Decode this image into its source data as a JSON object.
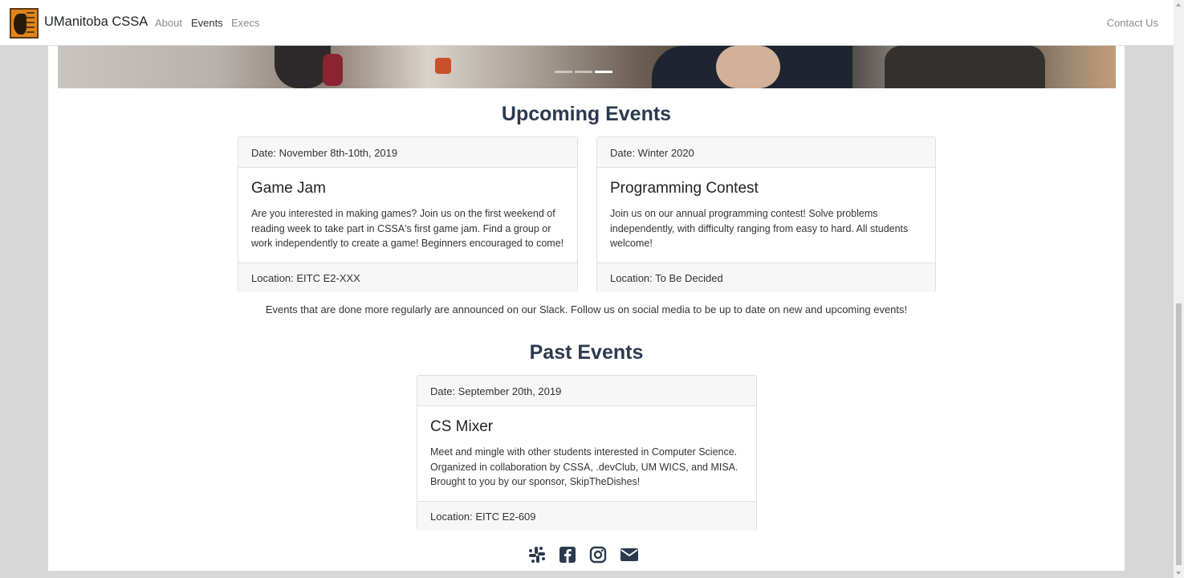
{
  "navbar": {
    "brand": "UManitoba CSSA",
    "links": [
      "About",
      "Events",
      "Execs"
    ],
    "active_link": "Events",
    "contact": "Contact Us"
  },
  "upcoming": {
    "title": "Upcoming Events",
    "events": [
      {
        "date": "Date: November 8th-10th, 2019",
        "name": "Game Jam",
        "description": "Are you interested in making games? Join us on the first weekend of reading week to take part in CSSA's first game jam. Find a group or work independently to create a game! Beginners encouraged to come!",
        "location": "Location: EITC E2-XXX"
      },
      {
        "date": "Date: Winter 2020",
        "name": "Programming Contest",
        "description": "Join us on our annual programming contest! Solve problems independently, with difficulty ranging from easy to hard. All students welcome!",
        "location": "Location: To Be Decided"
      }
    ]
  },
  "note": "Events that are done more regularly are announced on our Slack. Follow us on social media to be up to date on new and upcoming events!",
  "past": {
    "title": "Past Events",
    "events": [
      {
        "date": "Date: September 20th, 2019",
        "name": "CS Mixer",
        "description": "Meet and mingle with other students interested in Computer Science. Organized in collaboration by CSSA, .devClub, UM WICS, and MISA. Brought to you by our sponsor, SkipTheDishes!",
        "location": "Location: EITC E2-609"
      }
    ]
  },
  "social_icons": [
    "slack-icon",
    "facebook-icon",
    "instagram-icon",
    "email-icon"
  ],
  "carousel": {
    "slides": 3,
    "active_slide": 3
  },
  "colors": {
    "heading": "#2b3a4e",
    "logo": "#e2851a",
    "background": "#d7d7d7"
  }
}
